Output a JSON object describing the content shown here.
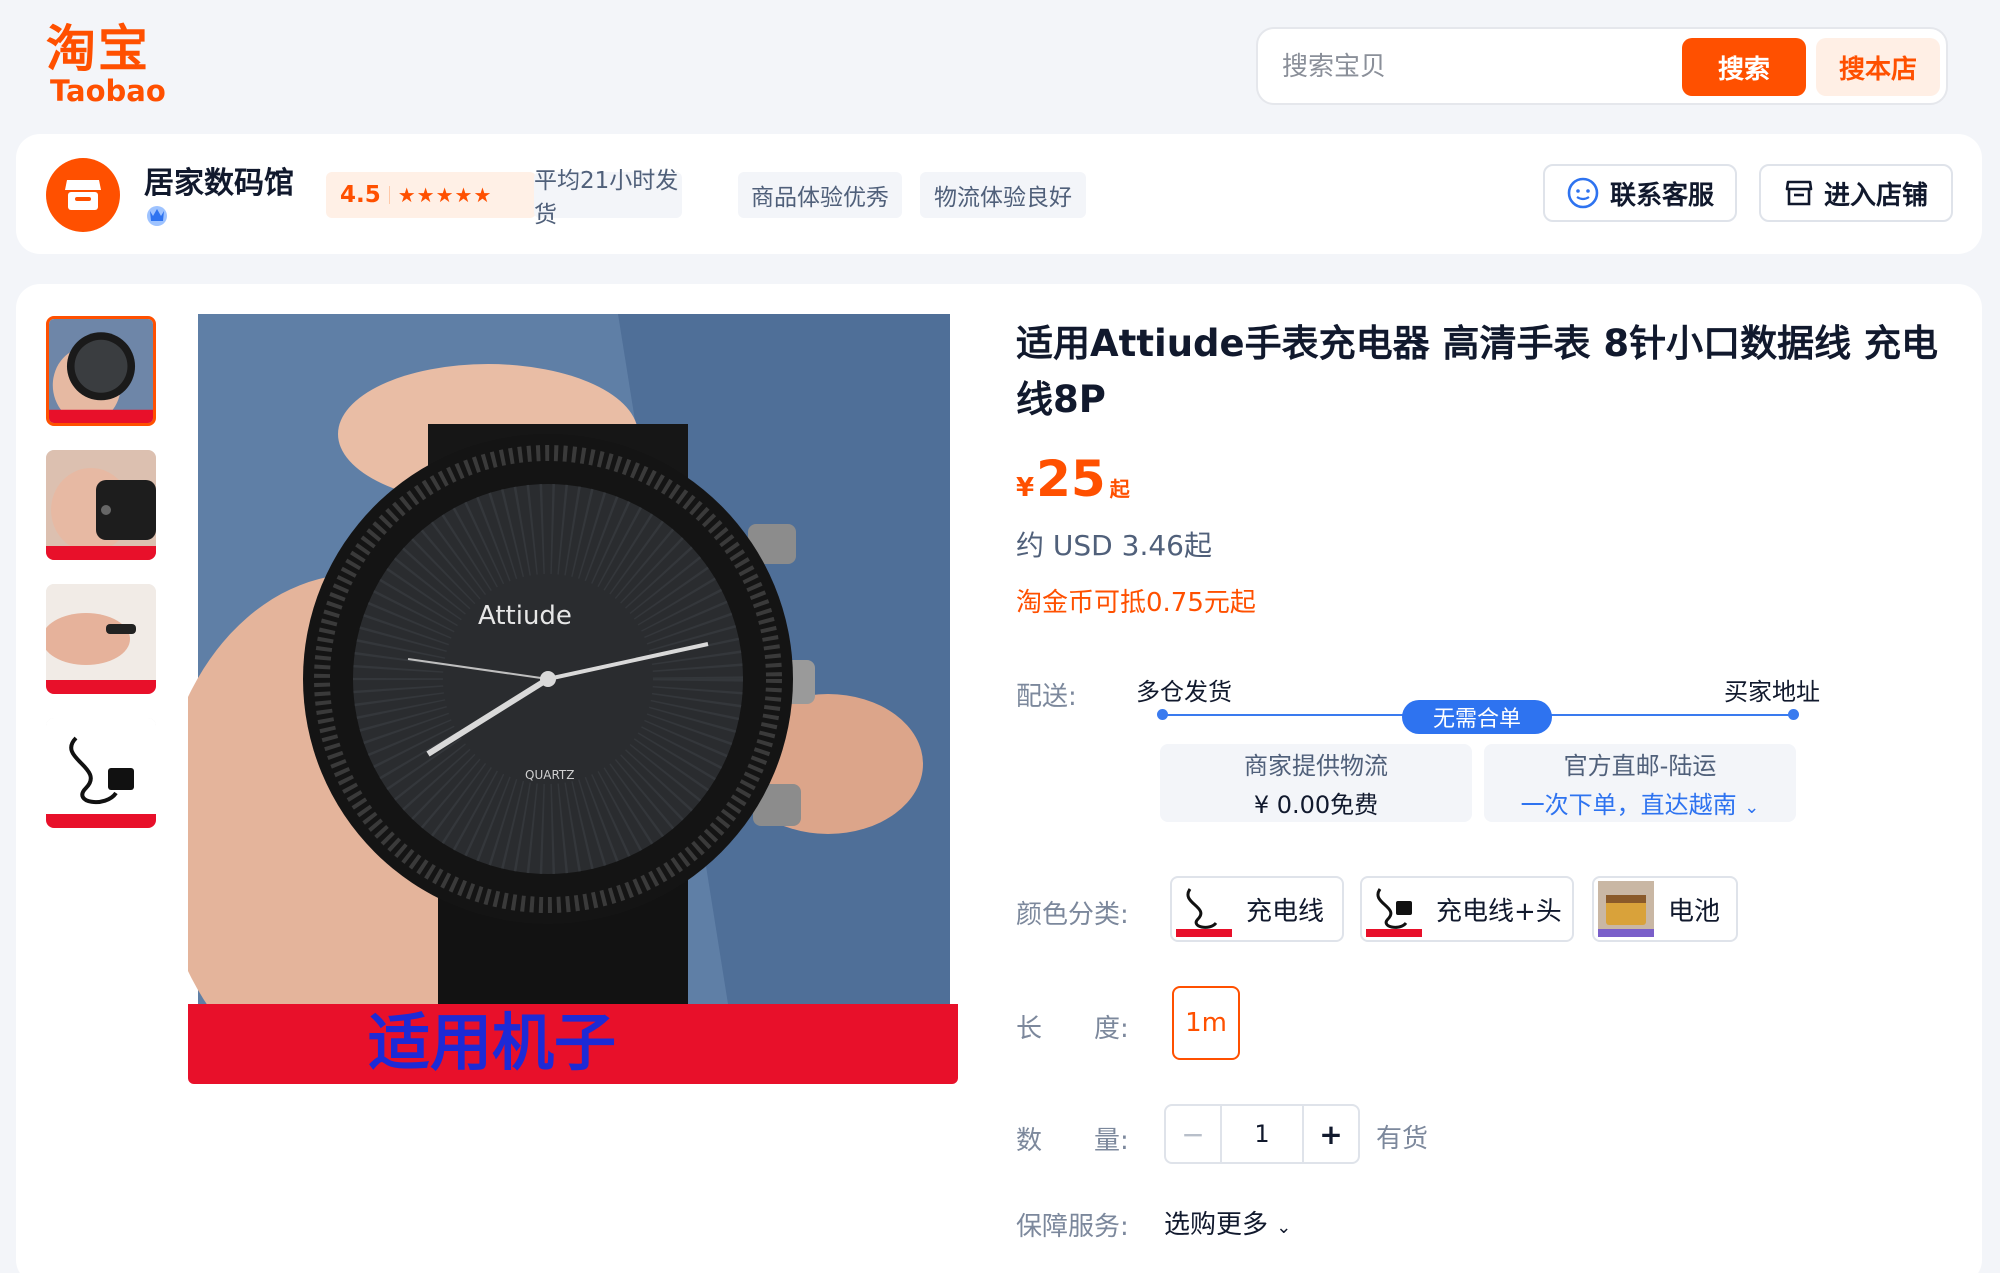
{
  "header": {
    "logo_cn": "淘宝",
    "logo_en": "Taobao",
    "search_placeholder": "搜索宝贝",
    "search_button": "搜索",
    "search_store_button": "搜本店"
  },
  "shop": {
    "name": "居家数码馆",
    "rating": "4.5",
    "stars": "★★★★★",
    "tags": [
      "平均21小时发货",
      "商品体验优秀",
      "物流体验良好"
    ],
    "contact_button": "联系客服",
    "enter_store_button": "进入店铺"
  },
  "product": {
    "title": "适用Attiude手表充电器 高清手表 8针小口数据线 充电线8P",
    "price_currency": "¥",
    "price_value": "25",
    "price_suffix": "起",
    "usd_price": "约 USD 3.46起",
    "coin_text": "淘金币可抵0.75元起",
    "image_banner_text": "适用机子",
    "image_watch_brand": "Attiude",
    "image_watch_sub": "QUARTZ"
  },
  "delivery": {
    "label": "配送:",
    "from": "多仓发货",
    "to": "买家地址",
    "pill": "无需合单",
    "option1_line1": "商家提供物流",
    "option1_line2": "¥ 0.00免费",
    "option2_line1": "官方直邮-陆运",
    "option2_line2": "一次下单，直达越南"
  },
  "color": {
    "label": "颜色分类:",
    "options": [
      "充电线",
      "充电线+头",
      "电池"
    ]
  },
  "length": {
    "label": "长　　度:",
    "options": [
      "1m"
    ]
  },
  "quantity": {
    "label": "数　　量:",
    "value": "1",
    "minus": "−",
    "plus": "+",
    "stock": "有货"
  },
  "guarantee": {
    "label": "保障服务:",
    "more": "选购更多"
  },
  "colors": {
    "brand": "#ff5000",
    "link_blue": "#2e73f0"
  }
}
